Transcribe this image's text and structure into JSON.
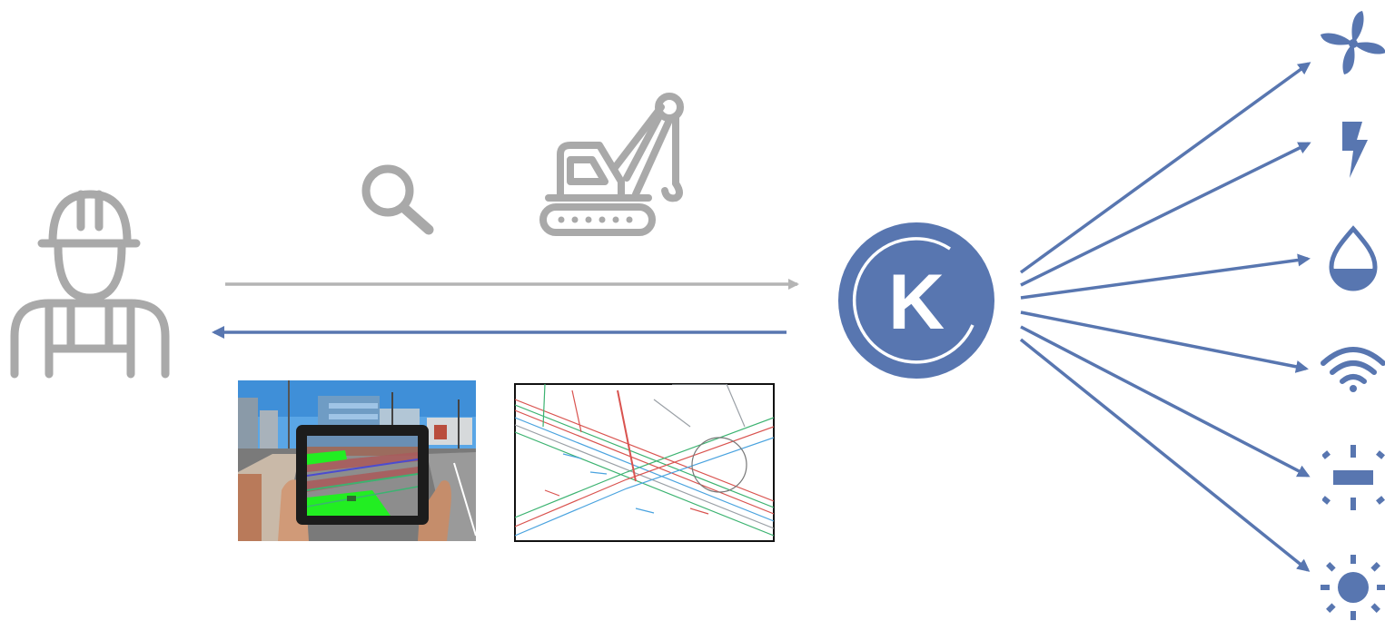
{
  "diagram": {
    "hub": {
      "letter": "K",
      "color": "#5876b0"
    },
    "colors": {
      "gray": "#a9a9a9",
      "blue": "#5876b0",
      "drawing_red": "#d9534f",
      "drawing_green": "#3cb371",
      "drawing_blue": "#4aa3df",
      "ar_green": "#22ee22"
    },
    "left_icons": [
      "construction-worker-icon",
      "magnifier-icon",
      "crane-icon"
    ],
    "thumbnails": [
      "ar-tablet-photo",
      "utility-drawing"
    ],
    "utility_icons": [
      "fan-icon",
      "lightning-icon",
      "water-drop-icon",
      "wifi-icon",
      "cable-icon",
      "sun-icon"
    ]
  }
}
